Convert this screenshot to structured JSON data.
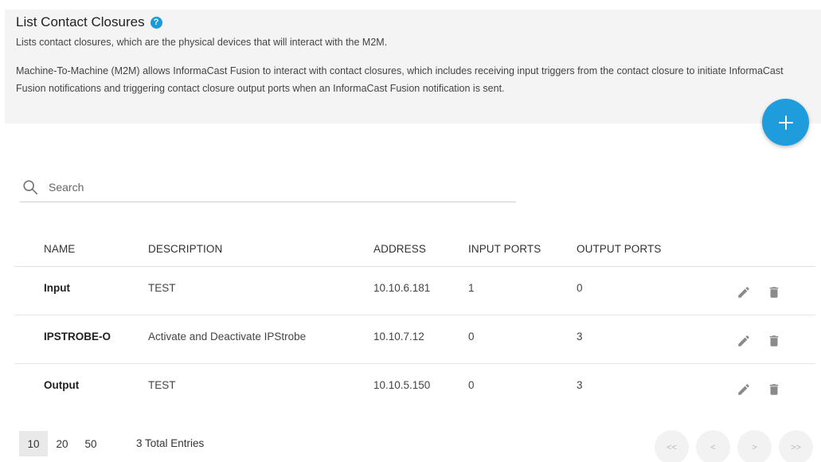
{
  "header": {
    "title": "List Contact Closures",
    "help_icon": "?",
    "subtitle": "Lists contact closures, which are the physical devices that will interact with the M2M.",
    "description": "Machine-To-Machine (M2M) allows InformaCast Fusion to interact with contact closures, which includes receiving input triggers from the contact closure to initiate InformaCast Fusion notifications and triggering contact closure output ports when an InformaCast Fusion notification is sent."
  },
  "add_button": {
    "icon": "plus-icon",
    "color": "#1f9cdc"
  },
  "search": {
    "placeholder": "Search",
    "value": ""
  },
  "table": {
    "headers": [
      "NAME",
      "DESCRIPTION",
      "ADDRESS",
      "INPUT PORTS",
      "OUTPUT PORTS"
    ],
    "rows": [
      {
        "name": "Input",
        "description": "TEST",
        "address": "10.10.6.181",
        "input_ports": "1",
        "output_ports": "0"
      },
      {
        "name": "IPSTROBE-O",
        "description": "Activate and Deactivate IPStrobe",
        "address": "10.10.7.12",
        "input_ports": "0",
        "output_ports": "3"
      },
      {
        "name": "Output",
        "description": "TEST",
        "address": "10.10.5.150",
        "input_ports": "0",
        "output_ports": "3"
      }
    ],
    "row_action_icons": [
      "pencil-icon",
      "trash-icon"
    ]
  },
  "pagination": {
    "page_sizes": [
      "10",
      "20",
      "50"
    ],
    "selected_page_size": "10",
    "total": "3 Total Entries",
    "first": "<<",
    "prev": "<",
    "next": ">",
    "last": ">>"
  },
  "colors": {
    "accent": "#1f9cdc",
    "help": "#1a9ad9",
    "icon_gray": "#8a8a8a"
  }
}
